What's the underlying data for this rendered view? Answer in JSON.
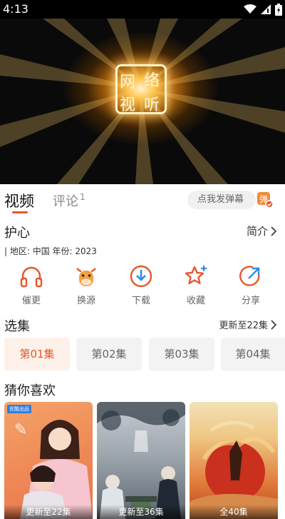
{
  "status_bar": {
    "time": "4:13"
  },
  "player": {
    "logo_chars": [
      "网",
      "络",
      "视",
      "听"
    ]
  },
  "tabs": {
    "video": "视频",
    "comment": "评论",
    "comment_count": "1"
  },
  "danmu": {
    "placeholder": "点我发弹幕",
    "icon_char": "弹"
  },
  "show": {
    "title": "护心",
    "intro_label": "简介",
    "meta": "| 地区: 中国   年份: 2023"
  },
  "actions": [
    {
      "label": "催更",
      "icon": "headphones-icon"
    },
    {
      "label": "换源",
      "icon": "cow-icon"
    },
    {
      "label": "下载",
      "icon": "download-icon"
    },
    {
      "label": "收藏",
      "icon": "star-icon"
    },
    {
      "label": "分享",
      "icon": "share-icon"
    }
  ],
  "episodes": {
    "heading": "选集",
    "update_label": "更新至22集",
    "items": [
      "第01集",
      "第02集",
      "第03集",
      "第04集"
    ],
    "active_index": 0
  },
  "recommend": {
    "heading": "猜你喜欢",
    "cards": [
      {
        "status": "更新至22集",
        "badge": "优酷出品"
      },
      {
        "status": "更新至36集"
      },
      {
        "status": "全40集"
      }
    ]
  },
  "colors": {
    "accent": "#e6572c",
    "tab_inactive": "#888888",
    "chip_bg": "#f3f3f3"
  }
}
